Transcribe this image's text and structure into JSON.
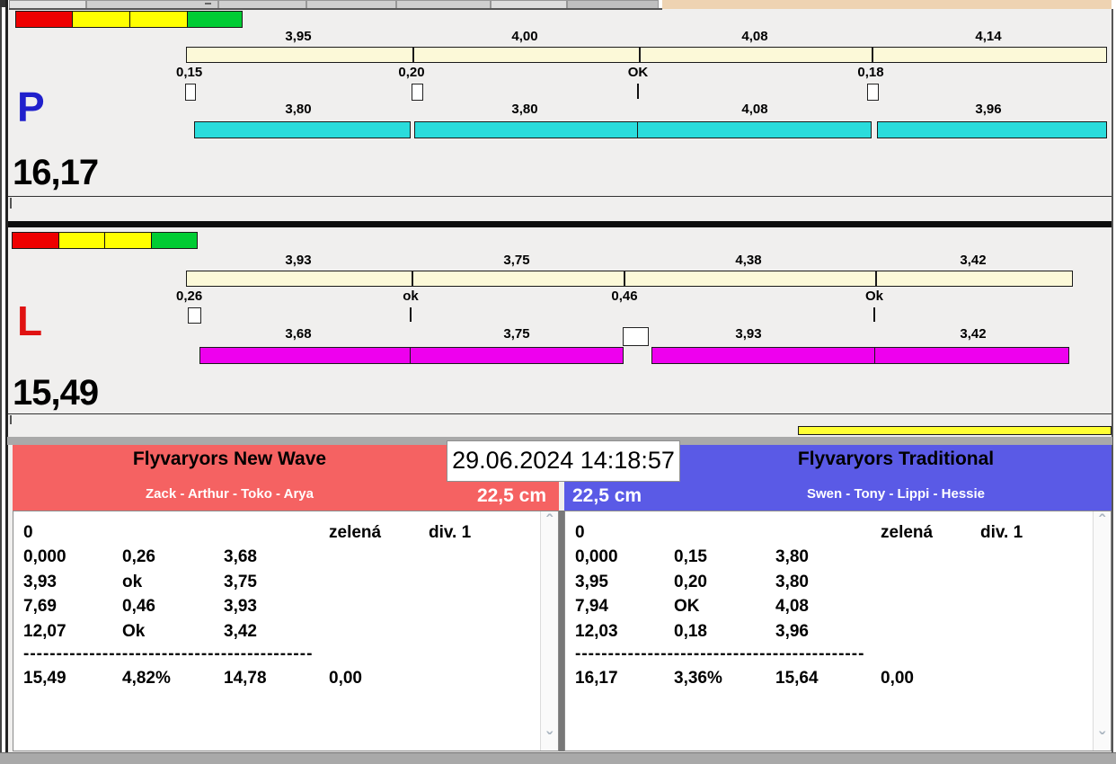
{
  "colors": {
    "app_bg": "#f0efee",
    "tan_strip": "#eed3b2",
    "indicator_red": "#ee0000",
    "indicator_yellow": "#ffff00",
    "indicator_green": "#00cc33",
    "split_bar": "#fcf9d8",
    "p_run_bar": "#2adcdc",
    "l_run_bar": "#ee00ee",
    "p_letter": "#2020cc",
    "l_letter": "#e01212",
    "left_header": "#f56262",
    "right_header": "#5a5ae6",
    "yellow_bar": "#ffff33",
    "band_gray": "#a9a9a9"
  },
  "icons": {
    "scroll_up": "ˆ",
    "scroll_down": "ˇ"
  },
  "datetime": "29.06.2024 14:18:57",
  "lanes": [
    {
      "id": "P",
      "total": "16,17",
      "split_labels": [
        "3,95",
        "4,00",
        "4,08",
        "4,14"
      ],
      "gate_labels": [
        "0,15",
        "0,20",
        "OK",
        "0,18"
      ],
      "run_labels": [
        "3,80",
        "3,80",
        "4,08",
        "3,96"
      ]
    },
    {
      "id": "L",
      "total": "15,49",
      "split_labels": [
        "3,93",
        "3,75",
        "4,38",
        "3,42"
      ],
      "gate_labels": [
        "0,26",
        "ok",
        "0,46",
        "Ok"
      ],
      "run_labels": [
        "3,68",
        "3,75",
        "3,93",
        "3,42"
      ]
    }
  ],
  "left_team": {
    "name": "Flyvaryors New Wave",
    "members": "Zack - Arthur - Toko - Arya",
    "height": "22,5 cm",
    "rows": [
      [
        "0",
        "",
        "",
        "zelená",
        "div. 1"
      ],
      [
        "0,000",
        "0,26",
        "3,68",
        "",
        ""
      ],
      [
        "3,93",
        "ok",
        "3,75",
        "",
        ""
      ],
      [
        "7,69",
        "0,46",
        "3,93",
        "",
        ""
      ],
      [
        "12,07",
        "Ok",
        "3,42",
        "",
        ""
      ]
    ],
    "dashes": "--------------------------------------------",
    "totals": [
      "15,49",
      "4,82%",
      "14,78",
      "0,00"
    ]
  },
  "right_team": {
    "name": "Flyvaryors Traditional",
    "members": "Swen - Tony - Lippi - Hessie",
    "height": "22,5 cm",
    "rows": [
      [
        "0",
        "",
        "",
        "zelená",
        "div. 1"
      ],
      [
        "0,000",
        "0,15",
        "3,80",
        "",
        ""
      ],
      [
        "3,95",
        "0,20",
        "3,80",
        "",
        ""
      ],
      [
        "7,94",
        "OK",
        "4,08",
        "",
        ""
      ],
      [
        "12,03",
        "0,18",
        "3,96",
        "",
        ""
      ]
    ],
    "dashes": "--------------------------------------------",
    "totals": [
      "16,17",
      "3,36%",
      "15,64",
      "0,00"
    ]
  }
}
